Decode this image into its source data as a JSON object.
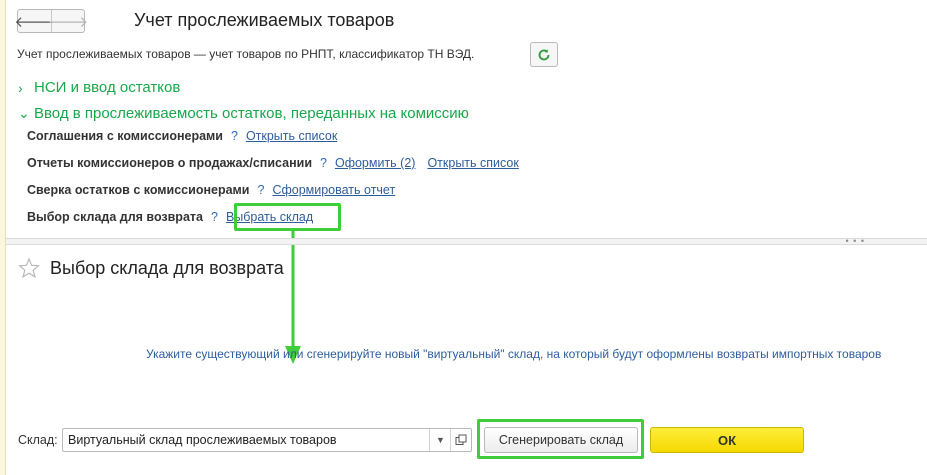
{
  "header": {
    "back_icon": "arrow-left-icon",
    "forward_icon": "arrow-right-icon",
    "back_glyph": "🡐",
    "forward_glyph": "🡒",
    "title": "Учет прослеживаемых товаров",
    "subtitle": "Учет прослеживаемых товаров — учет товаров по РНПТ, классификатор ТН ВЭД.",
    "refresh_icon": "refresh-icon"
  },
  "sections": [
    {
      "label": "НСИ и ввод остатков",
      "expanded": false
    },
    {
      "label": "Ввод в прослеживаемость остатков, переданных на комиссию",
      "expanded": true
    }
  ],
  "rows": [
    {
      "label": "Соглашения с комиссионерами",
      "help": "?",
      "links": [
        "Открыть список"
      ]
    },
    {
      "label": "Отчеты комиссионеров о продажах/списании",
      "help": "?",
      "links": [
        "Оформить (2)",
        "Открыть список"
      ]
    },
    {
      "label": "Сверка остатков с комиссионерами",
      "help": "?",
      "links": [
        "Сформировать отчет"
      ]
    },
    {
      "label": "Выбор склада для возврата",
      "help": "?",
      "links": [
        "Выбрать склад"
      ]
    }
  ],
  "chevrons": {
    "collapsed": "›",
    "expanded": "⌄"
  },
  "splitter": {
    "grip": "• • •"
  },
  "form": {
    "star_icon": "star-outline-icon",
    "title": "Выбор склада для возврата",
    "info": "Укажите существующий или сгенерируйте новый \"виртуальный\" склад, на который будут оформлены возвраты импортных товаров",
    "warehouse_label": "Склад:",
    "warehouse_value": "Виртуальный склад прослеживаемых товаров",
    "dropdown_glyph": "▼",
    "generate_button": "Сгенерировать склад",
    "ok_button": "ОК"
  },
  "colors": {
    "accent_green": "#18a84a",
    "highlight": "#3fce3a",
    "link": "#2e5d9c",
    "ok_yellow": "#f4d900"
  }
}
